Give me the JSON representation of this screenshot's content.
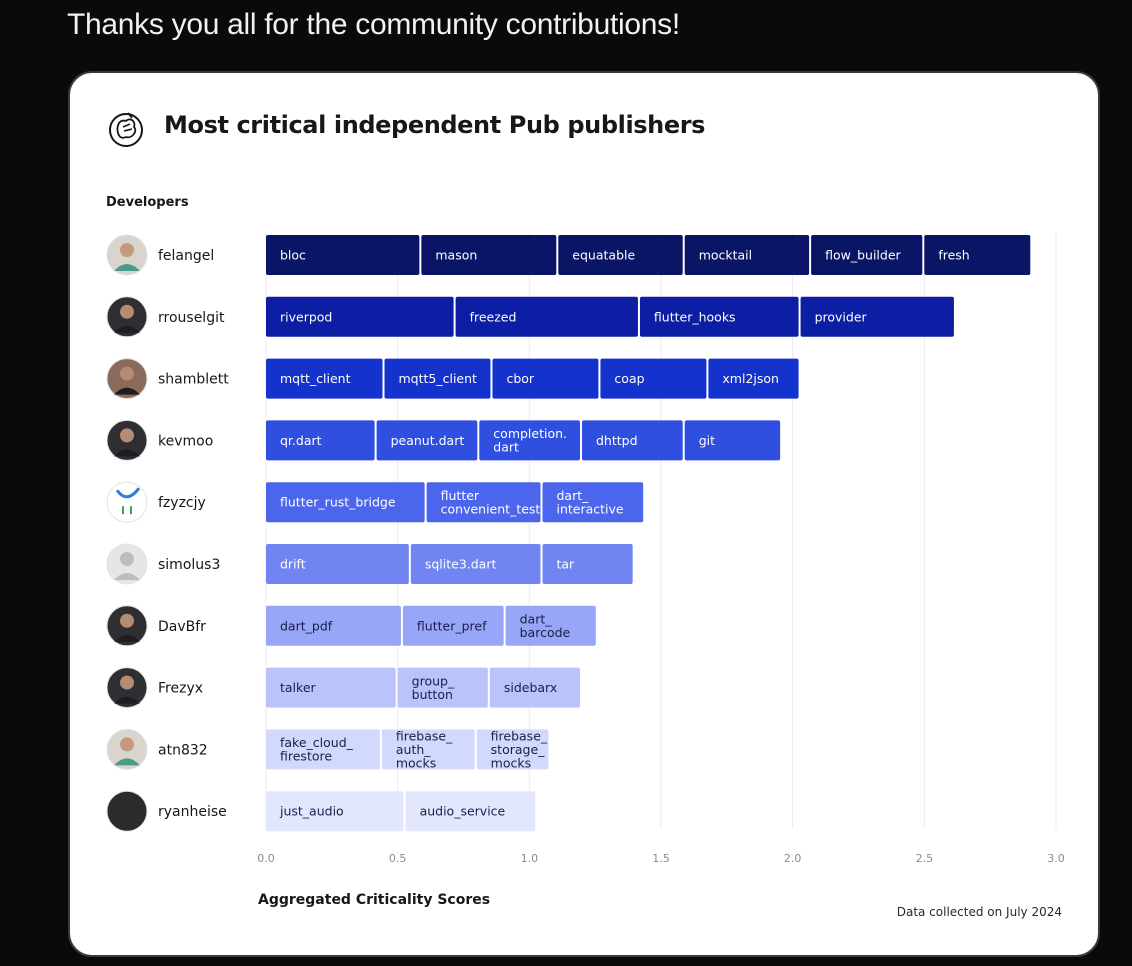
{
  "post": {
    "text": "Thanks you all for the community contributions!"
  },
  "card": {
    "title": "Most critical independent Pub publishers",
    "logo_icon": "dart-hand-logo-icon",
    "developers_label": "Developers",
    "footnote": "Data collected on July 2024"
  },
  "chart_data": {
    "type": "bar",
    "orientation": "horizontal",
    "stacked": true,
    "title": "Most critical independent Pub publishers",
    "xlabel": "Aggregated Criticality Scores",
    "ylabel": "Developers",
    "xlim": [
      0,
      3.0
    ],
    "xticks": [
      "0.0",
      "0.5",
      "1.0",
      "1.5",
      "2.0",
      "2.5",
      "3.0"
    ],
    "grid": true,
    "rows": [
      {
        "developer": "felangel",
        "color": "#0b1565",
        "avatar": "light",
        "packages": [
          {
            "name": "bloc",
            "value": 0.59
          },
          {
            "name": "mason",
            "value": 0.52
          },
          {
            "name": "equatable",
            "value": 0.48
          },
          {
            "name": "mocktail",
            "value": 0.48
          },
          {
            "name": "flow_builder",
            "value": 0.43
          },
          {
            "name": "fresh",
            "value": 0.41
          }
        ]
      },
      {
        "developer": "rrouselgit",
        "color": "#0c1ea3",
        "avatar": "dark",
        "packages": [
          {
            "name": "riverpod",
            "value": 0.72
          },
          {
            "name": "freezed",
            "value": 0.7
          },
          {
            "name": "flutter_hooks",
            "value": 0.61
          },
          {
            "name": "provider",
            "value": 0.59
          }
        ]
      },
      {
        "developer": "shamblett",
        "color": "#1432cc",
        "avatar": "warm",
        "packages": [
          {
            "name": "mqtt_client",
            "value": 0.45
          },
          {
            "name": "mqtt5_client",
            "value": 0.41
          },
          {
            "name": "cbor",
            "value": 0.41
          },
          {
            "name": "coap",
            "value": 0.41
          },
          {
            "name": "xml2json",
            "value": 0.35
          }
        ]
      },
      {
        "developer": "kevmoo",
        "color": "#2f4fe0",
        "avatar": "dark",
        "packages": [
          {
            "name": "qr.dart",
            "value": 0.42
          },
          {
            "name": "peanut.dart",
            "value": 0.39
          },
          {
            "name": "completion.\ndart",
            "value": 0.39
          },
          {
            "name": "dhttpd",
            "value": 0.39
          },
          {
            "name": "git",
            "value": 0.37
          }
        ]
      },
      {
        "developer": "fzyzcjy",
        "color": "#4b66ec",
        "avatar": "logo",
        "packages": [
          {
            "name": "flutter_rust_bridge",
            "value": 0.61
          },
          {
            "name": "flutter\nconvenient_test",
            "value": 0.44
          },
          {
            "name": "dart_\ninteractive",
            "value": 0.39
          }
        ]
      },
      {
        "developer": "simolus3",
        "color": "#7085f1",
        "avatar": "grey",
        "packages": [
          {
            "name": "drift",
            "value": 0.55
          },
          {
            "name": "sqlite3.dart",
            "value": 0.5
          },
          {
            "name": "tar",
            "value": 0.35
          }
        ]
      },
      {
        "developer": "DavBfr",
        "color": "#97a6f6",
        "avatar": "dark",
        "packages": [
          {
            "name": "dart_pdf",
            "value": 0.52
          },
          {
            "name": "flutter_pref",
            "value": 0.39
          },
          {
            "name": "dart_\nbarcode",
            "value": 0.35
          }
        ]
      },
      {
        "developer": "Frezyx",
        "color": "#bac4fa",
        "avatar": "dark",
        "packages": [
          {
            "name": "talker",
            "value": 0.5
          },
          {
            "name": "group_\nbutton",
            "value": 0.35
          },
          {
            "name": "sidebarx",
            "value": 0.35
          }
        ]
      },
      {
        "developer": "atn832",
        "color": "#d2d9fc",
        "avatar": "light",
        "packages": [
          {
            "name": "fake_cloud_\nfirestore",
            "value": 0.44
          },
          {
            "name": "firebase_\nauth_\nmocks",
            "value": 0.36
          },
          {
            "name": "firebase_\nstorage_\nmocks",
            "value": 0.28
          }
        ]
      },
      {
        "developer": "ryanheise",
        "color": "#e3e7fd",
        "avatar": "black",
        "packages": [
          {
            "name": "just_audio",
            "value": 0.53
          },
          {
            "name": "audio_service",
            "value": 0.5
          }
        ]
      }
    ]
  }
}
